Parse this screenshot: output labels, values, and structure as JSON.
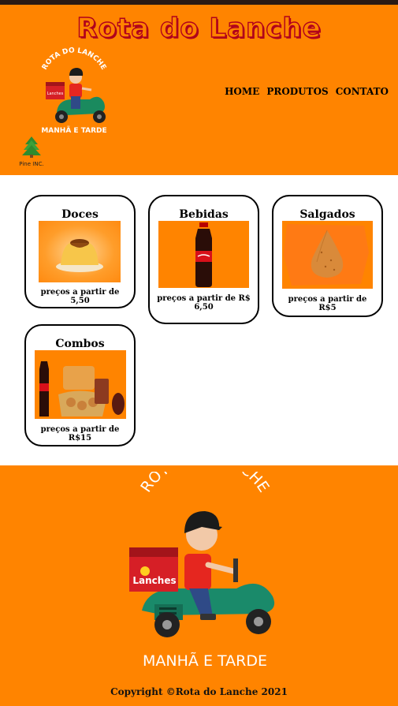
{
  "header": {
    "site_title": "Rota do Lanche",
    "logo_top_text": "ROTA DO LANCHE",
    "logo_bottom_text": "MANHÃ E TARDE",
    "box_text": "Lanches",
    "pine_label": "Pine INC."
  },
  "nav": {
    "items": [
      {
        "label": "HOME"
      },
      {
        "label": "PRODUTOS"
      },
      {
        "label": "CONTATO"
      }
    ]
  },
  "products": [
    {
      "title": "Doces",
      "price": "preços a partir de 5,50",
      "image": "pudim-image"
    },
    {
      "title": "Bebidas",
      "price": "preços a partir de R$ 6,50",
      "image": "coca-cola-image"
    },
    {
      "title": "Salgados",
      "price": "preços a partir de R$5",
      "image": "coxinha-image"
    },
    {
      "title": "Combos",
      "price": "preços a partir de R$15",
      "image": "combo-image"
    }
  ],
  "footer": {
    "logo_top_text": "ROTA DO LANCHE",
    "logo_bottom_text": "MANHÃ E TARDE",
    "box_text": "Lanches",
    "copyright": "Copyright ©Rota do Lanche 2021"
  },
  "colors": {
    "brand_orange": "#ff8400",
    "title_red": "#b0001c",
    "topbar": "#2a1a14"
  }
}
